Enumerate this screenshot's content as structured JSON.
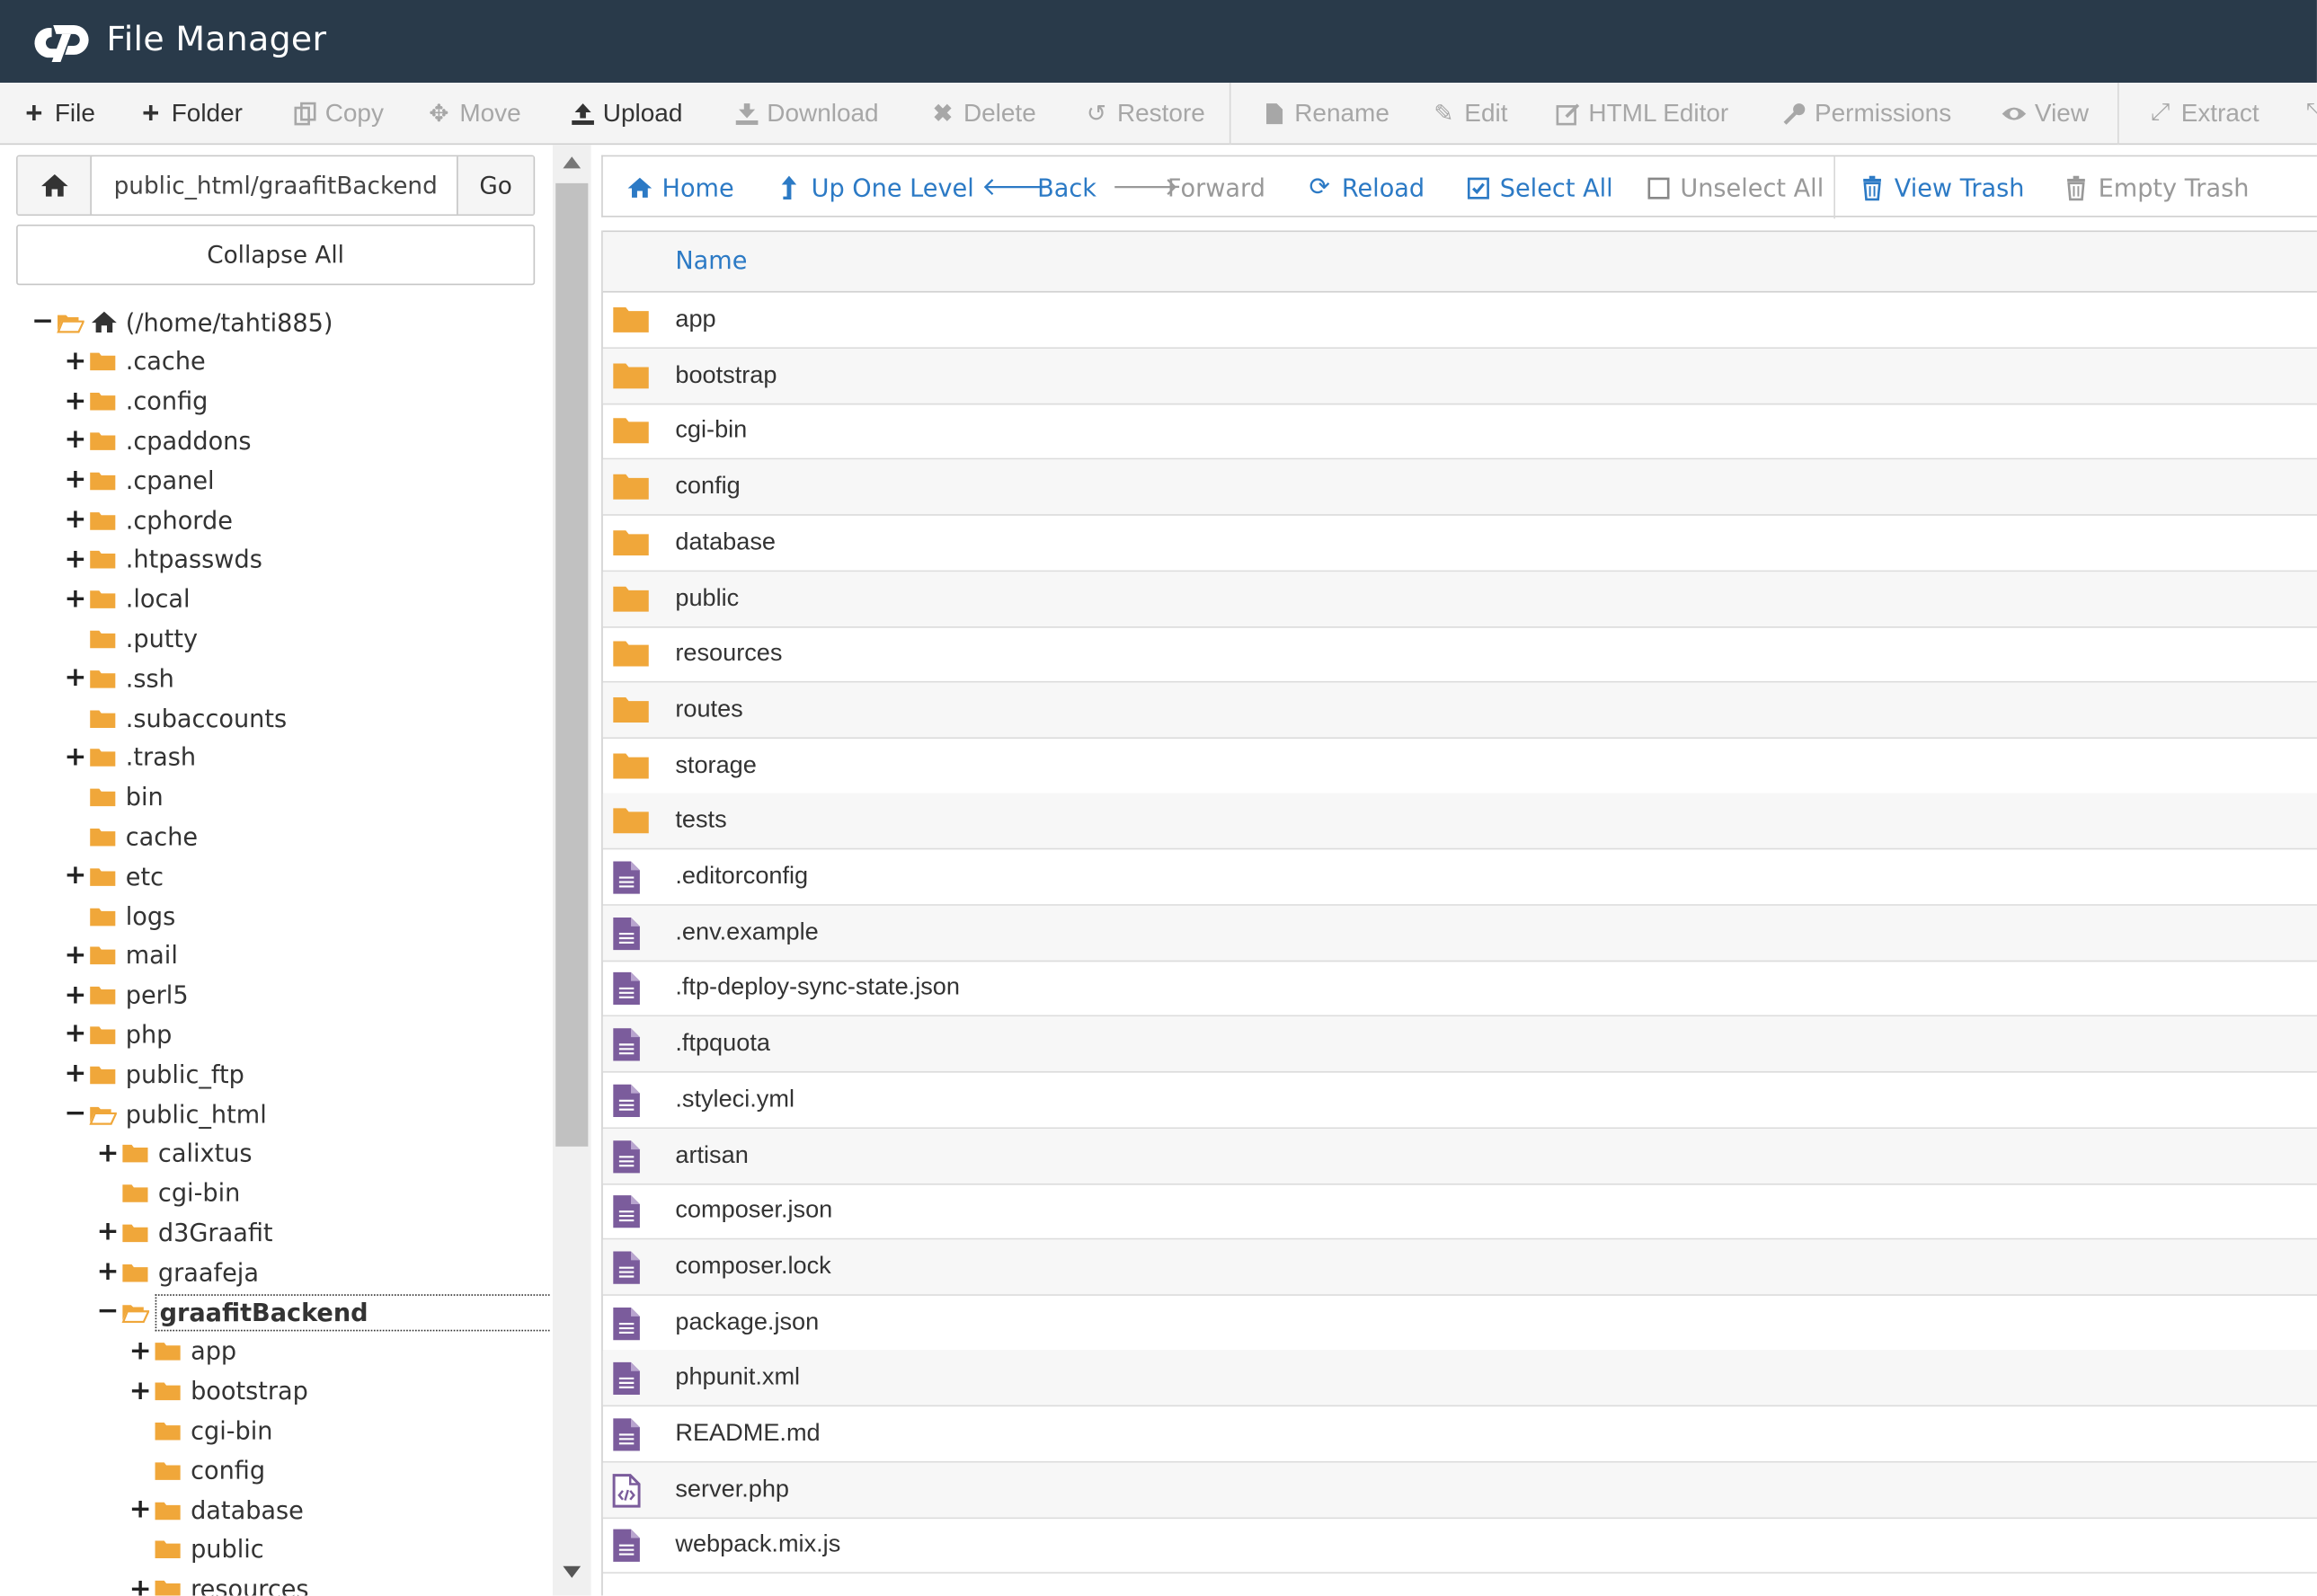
{
  "header": {
    "title": "File Manager"
  },
  "toolbar": {
    "file": "File",
    "folder": "Folder",
    "copy": "Copy",
    "move": "Move",
    "upload": "Upload",
    "download": "Download",
    "delete": "Delete",
    "restore": "Restore",
    "rename": "Rename",
    "edit": "Edit",
    "html_editor": "HTML Editor",
    "permissions": "Permissions",
    "view": "View",
    "extract": "Extract"
  },
  "sidebar": {
    "path": "public_html/graafitBackend",
    "go": "Go",
    "collapse_all": "Collapse All",
    "tree": [
      {
        "label": "(/home/tahti885)",
        "toggle": "−",
        "open": true,
        "home": true
      },
      {
        "label": ".cache",
        "toggle": "+"
      },
      {
        "label": ".config",
        "toggle": "+"
      },
      {
        "label": ".cpaddons",
        "toggle": "+"
      },
      {
        "label": ".cpanel",
        "toggle": "+"
      },
      {
        "label": ".cphorde",
        "toggle": "+"
      },
      {
        "label": ".htpasswds",
        "toggle": "+"
      },
      {
        "label": ".local",
        "toggle": "+"
      },
      {
        "label": ".putty",
        "toggle": ""
      },
      {
        "label": ".ssh",
        "toggle": "+"
      },
      {
        "label": ".subaccounts",
        "toggle": ""
      },
      {
        "label": ".trash",
        "toggle": "+"
      },
      {
        "label": "bin",
        "toggle": ""
      },
      {
        "label": "cache",
        "toggle": ""
      },
      {
        "label": "etc",
        "toggle": "+"
      },
      {
        "label": "logs",
        "toggle": ""
      },
      {
        "label": "mail",
        "toggle": "+"
      },
      {
        "label": "perl5",
        "toggle": "+"
      },
      {
        "label": "php",
        "toggle": "+"
      },
      {
        "label": "public_ftp",
        "toggle": "+"
      },
      {
        "label": "public_html",
        "toggle": "−",
        "open": true
      },
      {
        "label": "calixtus",
        "toggle": "+"
      },
      {
        "label": "cgi-bin",
        "toggle": ""
      },
      {
        "label": "d3Graafit",
        "toggle": "+"
      },
      {
        "label": "graafeja",
        "toggle": "+"
      },
      {
        "label": "graafitBackend",
        "toggle": "−",
        "open": true,
        "current": true
      },
      {
        "label": "app",
        "toggle": "+"
      },
      {
        "label": "bootstrap",
        "toggle": "+"
      },
      {
        "label": "cgi-bin",
        "toggle": ""
      },
      {
        "label": "config",
        "toggle": ""
      },
      {
        "label": "database",
        "toggle": "+"
      },
      {
        "label": "public",
        "toggle": ""
      },
      {
        "label": "resources",
        "toggle": "+"
      }
    ]
  },
  "nav": {
    "home": "Home",
    "up": "Up One Level",
    "back": "Back",
    "forward": "Forward",
    "reload": "Reload",
    "select_all": "Select All",
    "unselect_all": "Unselect All",
    "view_trash": "View Trash",
    "empty_trash": "Empty Trash"
  },
  "table": {
    "header_name": "Name",
    "rows": [
      {
        "name": "app",
        "type": "folder"
      },
      {
        "name": "bootstrap",
        "type": "folder"
      },
      {
        "name": "cgi-bin",
        "type": "folder"
      },
      {
        "name": "config",
        "type": "folder"
      },
      {
        "name": "database",
        "type": "folder"
      },
      {
        "name": "public",
        "type": "folder"
      },
      {
        "name": "resources",
        "type": "folder"
      },
      {
        "name": "routes",
        "type": "folder"
      },
      {
        "name": "storage",
        "type": "folder"
      },
      {
        "name": "tests",
        "type": "folder"
      },
      {
        "name": ".editorconfig",
        "type": "text"
      },
      {
        "name": ".env.example",
        "type": "text"
      },
      {
        "name": ".ftp-deploy-sync-state.json",
        "type": "text"
      },
      {
        "name": ".ftpquota",
        "type": "text"
      },
      {
        "name": ".styleci.yml",
        "type": "text"
      },
      {
        "name": "artisan",
        "type": "text"
      },
      {
        "name": "composer.json",
        "type": "text"
      },
      {
        "name": "composer.lock",
        "type": "text"
      },
      {
        "name": "package.json",
        "type": "text"
      },
      {
        "name": "phpunit.xml",
        "type": "text"
      },
      {
        "name": "README.md",
        "type": "text"
      },
      {
        "name": "server.php",
        "type": "code"
      },
      {
        "name": "webpack.mix.js",
        "type": "text"
      }
    ]
  },
  "colors": {
    "header_bg": "#293a4a",
    "link": "#2c7ac5",
    "folder": "#f0a73a",
    "file": "#7b5c9c"
  }
}
